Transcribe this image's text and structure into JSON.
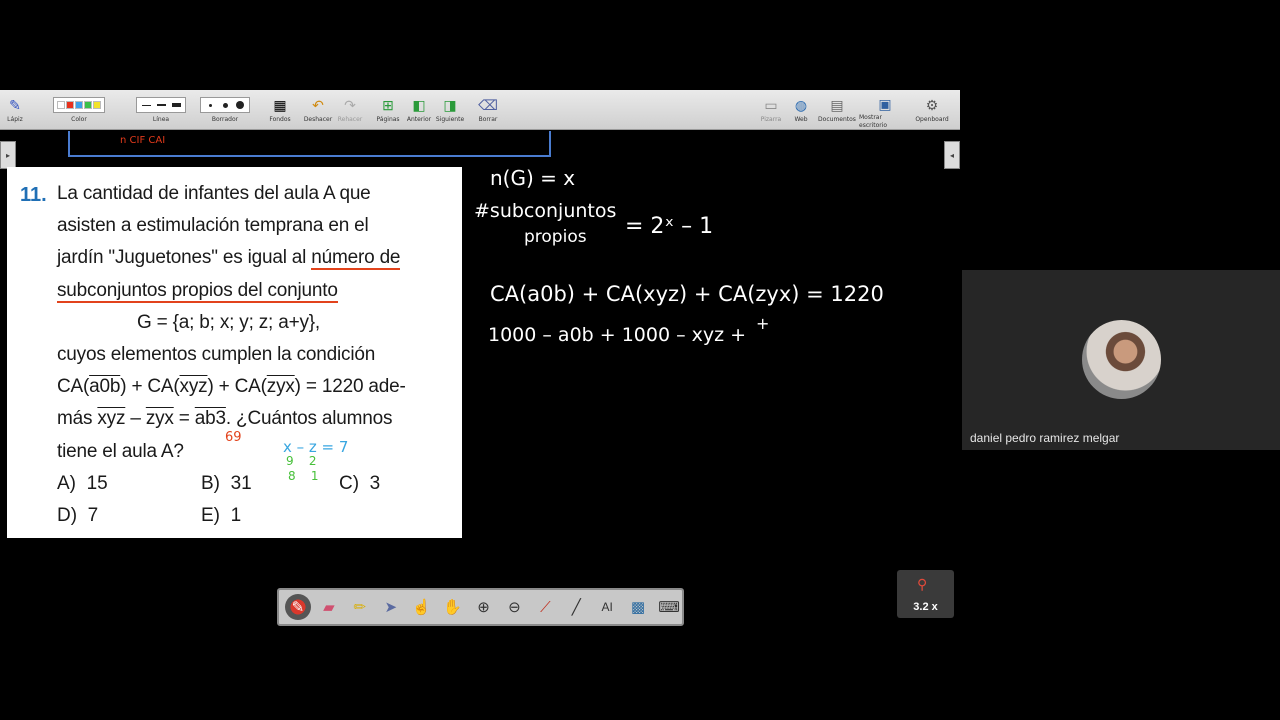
{
  "toolbar": {
    "left_groups": [
      {
        "label": "Lápiz",
        "icon": "pen-icon"
      },
      {
        "label": "Color",
        "icon": "color-palette"
      },
      {
        "label": "Línea",
        "icon": "line-width"
      },
      {
        "label": "Borrador",
        "icon": "eraser-size"
      },
      {
        "label": "Fondos",
        "icon": "background-icon"
      },
      {
        "label": "Deshacer",
        "icon": "undo-icon"
      },
      {
        "label": "Rehacer",
        "icon": "redo-icon"
      },
      {
        "label": "Páginas",
        "icon": "pages-icon"
      },
      {
        "label": "Anterior",
        "icon": "previous-page-icon"
      },
      {
        "label": "Siguiente",
        "icon": "next-page-icon"
      },
      {
        "label": "Borrar",
        "icon": "clear-icon"
      }
    ],
    "right_groups": [
      {
        "label": "Pizarra",
        "icon": "whiteboard-icon"
      },
      {
        "label": "Web",
        "icon": "globe-icon"
      },
      {
        "label": "Documentos",
        "icon": "folder-icon"
      },
      {
        "label": "Mostrar escritorio",
        "icon": "desktop-icon"
      },
      {
        "label": "Openboard",
        "icon": "settings-icon"
      }
    ],
    "colors": [
      "#ffffff",
      "#e8301c",
      "#3aa0e8",
      "#3ac04a",
      "#f2e22a"
    ]
  },
  "banner": {
    "text": "n CIF CAI"
  },
  "problem": {
    "number": "11.",
    "lines": [
      "La cantidad de infantes del aula A que",
      "asisten a estimulación temprana en el",
      "jardín \"Juguetones\" es igual al ",
      "número de",
      "subconjuntos propios del conjunto",
      "G = {a; b; x; y; z; a+y},",
      "cuyos elementos cumplen la condición",
      "CA(",
      "a0b",
      ") + CA(",
      "xyz",
      ") + CA(",
      "zyx",
      ") = 1220 ade-",
      "más ",
      "xyz",
      " – ",
      "zyx",
      " = ",
      "ab3",
      ". ¿Cuántos alumnos",
      "tiene el aula A?"
    ],
    "options": [
      {
        "label": "A)",
        "value": "15"
      },
      {
        "label": "B)",
        "value": "31"
      },
      {
        "label": "C)",
        "value": "3"
      },
      {
        "label": "D)",
        "value": "7"
      },
      {
        "label": "E)",
        "value": "1"
      }
    ],
    "annotations": {
      "orange": "69",
      "blue": "x – z = 7",
      "green_top": "9    2",
      "green_bottom": "8    1"
    }
  },
  "whiteboard": {
    "line1": "n(G) = x",
    "line2a": "#subconjuntos",
    "line2b": "propios",
    "line2c": "= 2ˣ – 1",
    "line3": "CA(a0b) + CA(xyz) + CA(zyx) = 1220",
    "line4": "1000 – a0b + 1000 – xyz + "
  },
  "webcam": {
    "name": "daniel pedro ramirez melgar"
  },
  "zoom": {
    "label": "3.2 x"
  }
}
